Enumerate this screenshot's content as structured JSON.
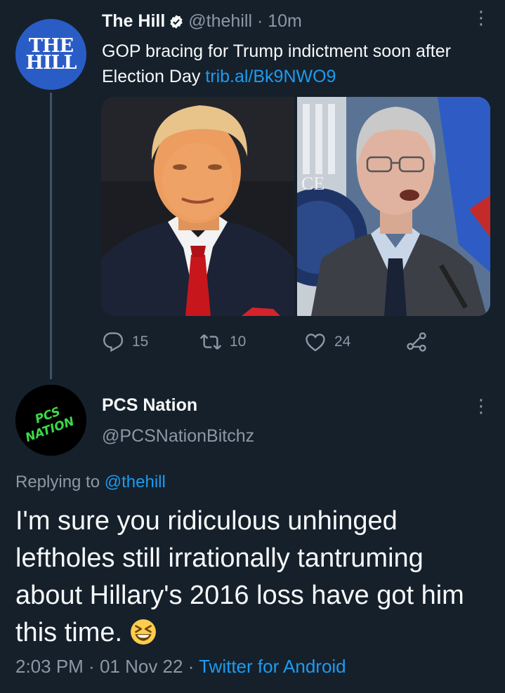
{
  "tweet1": {
    "avatar_text": [
      "THE",
      "HILL"
    ],
    "name": "The Hill",
    "handle": "@thehill",
    "separator": " · ",
    "time": "10m",
    "text": "GOP bracing for Trump indictment soon after Election Day ",
    "link": "trib.al/Bk9NWO9",
    "more": "⋮",
    "media_sign_text": "CE",
    "stats": {
      "replies": "15",
      "retweets": "10",
      "likes": "24"
    }
  },
  "tweet2": {
    "avatar_text": [
      "PCS",
      "NATION"
    ],
    "name": "PCS Nation",
    "handle": "@PCSNationBitchz",
    "more": "⋮",
    "replying_prefix": "Replying to ",
    "replying_to": "@thehill",
    "text": "I'm sure you ridiculous unhinged leftholes still irrationally tantruming about Hillary's 2016 loss have got him this time.",
    "time": "2:03 PM",
    "sep1": " · ",
    "date": "01 Nov 22",
    "sep2": " · ",
    "source": "Twitter for Android"
  },
  "colors": {
    "background": "#15202b",
    "text": "#f7f9f9",
    "muted": "#8b98a5",
    "link": "#1d9bf0",
    "hill_blue": "#2a5cc6",
    "pcs_green": "#3dd94a"
  },
  "icons": [
    "verified-badge-icon",
    "reply-icon",
    "retweet-icon",
    "like-icon",
    "share-icon",
    "more-options-icon",
    "grinning-squinting-emoji"
  ]
}
